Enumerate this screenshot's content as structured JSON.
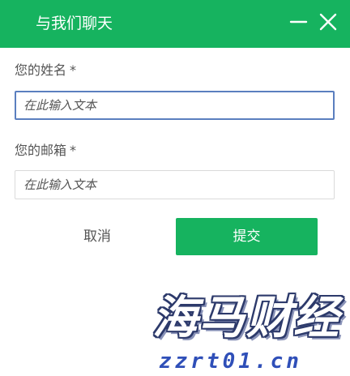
{
  "dialog": {
    "title": "与我们聊天",
    "accent_color": "#16b35f",
    "minimize_icon": "minimize-icon",
    "close_icon": "close-icon"
  },
  "form": {
    "name_label": "您的姓名",
    "name_required": "*",
    "name_placeholder": "在此输入文本",
    "email_label": "您的邮箱",
    "email_required": "*",
    "email_placeholder": "在此输入文本"
  },
  "actions": {
    "cancel_label": "取消",
    "submit_label": "提交"
  },
  "watermark": {
    "logo_text": "海马财经",
    "url_text": "zzrt01.cn"
  }
}
